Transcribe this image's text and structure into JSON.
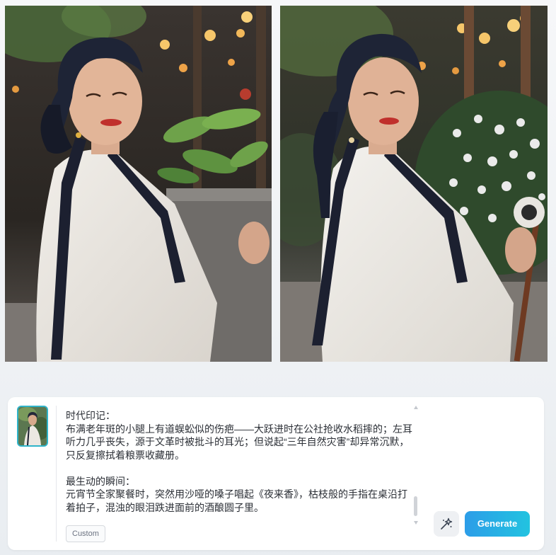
{
  "gallery": {
    "images": [
      {
        "alt": "generated-image-1"
      },
      {
        "alt": "generated-image-2"
      }
    ]
  },
  "composer": {
    "prompt_text": "时代印记：\n布满老年斑的小腿上有道蜈蚣似的伤疤——大跃进时在公社抢收水稻摔的；左耳听力几乎丧失，源于文革时被批斗的耳光；但说起“三年自然灾害”却异常沉默，只反复擦拭着粮票收藏册。\n\n最生动的瞬间：\n元宵节全家聚餐时，突然用沙哑的嗓子唱起《夜来香》，枯枝般的手指在桌沿打着拍子，混浊的眼泪跌进面前的酒酿圆子里。",
    "tag_label": "Custom",
    "generate_label": "Generate",
    "magic_icon": "sparkle-wand-icon"
  },
  "colors": {
    "accent_start": "#2c9de8",
    "accent_end": "#22c3e0",
    "thumb_border": "#2fb4c9"
  }
}
